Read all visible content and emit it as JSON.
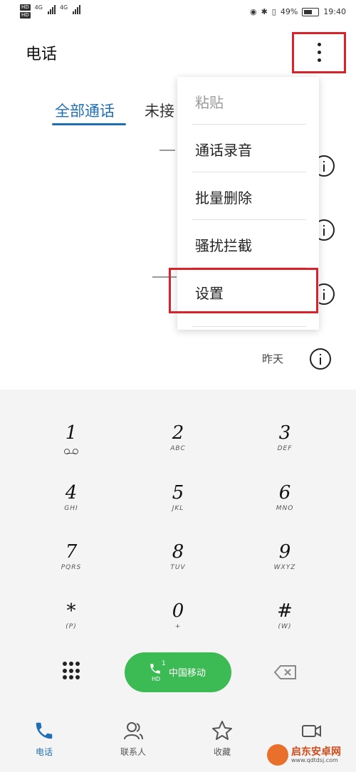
{
  "status_bar": {
    "hd1": "HD",
    "hd2": "HD",
    "net1": "4G",
    "net2": "4G",
    "battery": "49%",
    "time": "19:40"
  },
  "header": {
    "title": "电话"
  },
  "tabs": {
    "all": "全部通话",
    "missed": "未接"
  },
  "call_log": {
    "date": "昨天"
  },
  "menu": {
    "items": [
      {
        "label": "粘贴",
        "enabled": false
      },
      {
        "label": "通话录音",
        "enabled": true
      },
      {
        "label": "批量删除",
        "enabled": true
      },
      {
        "label": "骚扰拦截",
        "enabled": true
      },
      {
        "label": "设置",
        "enabled": true
      }
    ]
  },
  "dialpad": {
    "keys": [
      {
        "num": "1",
        "sub": ""
      },
      {
        "num": "2",
        "sub": "ABC"
      },
      {
        "num": "3",
        "sub": "DEF"
      },
      {
        "num": "4",
        "sub": "GHI"
      },
      {
        "num": "5",
        "sub": "JKL"
      },
      {
        "num": "6",
        "sub": "MNO"
      },
      {
        "num": "7",
        "sub": "PQRS"
      },
      {
        "num": "8",
        "sub": "TUV"
      },
      {
        "num": "9",
        "sub": "WXYZ"
      },
      {
        "num": "*",
        "sub": "(P)"
      },
      {
        "num": "0",
        "sub": "+"
      },
      {
        "num": "#",
        "sub": "(W)"
      }
    ],
    "call_button": {
      "sim": "1",
      "hd": "HD",
      "carrier": "中国移动"
    }
  },
  "bottom_nav": {
    "items": [
      {
        "label": "电话"
      },
      {
        "label": "联系人"
      },
      {
        "label": "收藏"
      },
      {
        "label": ""
      }
    ]
  },
  "watermark": {
    "name": "启东安卓网",
    "url": "www.qdtdsj.com"
  },
  "colors": {
    "accent": "#1f6fb7",
    "call_green": "#3cba54",
    "highlight_red": "#d8232a",
    "dialpad_bg": "#f4f4f4"
  }
}
